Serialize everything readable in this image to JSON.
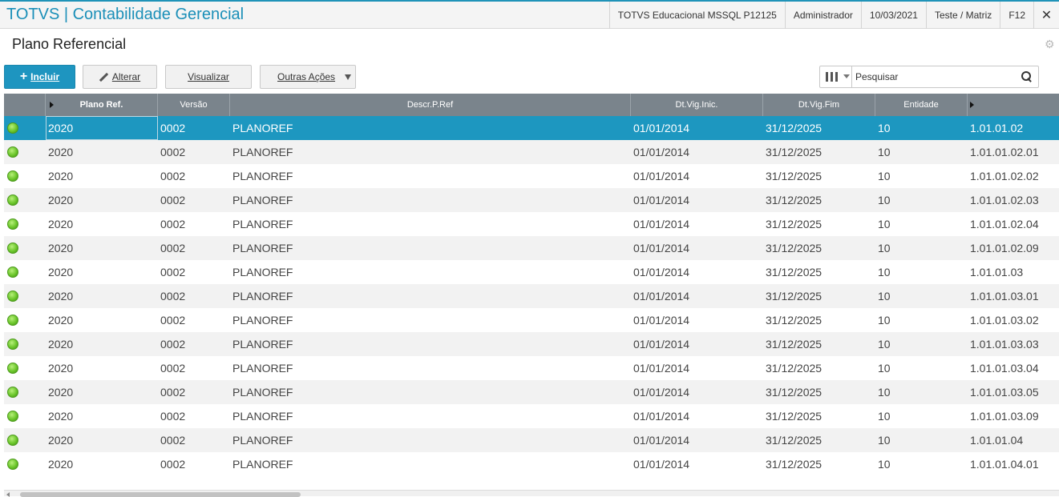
{
  "header": {
    "app_title": "TOTVS | Contabilidade Gerencial",
    "environment": "TOTVS Educacional MSSQL P12125",
    "user": "Administrador",
    "date": "10/03/2021",
    "branch": "Teste / Matriz",
    "help_key": "F12",
    "close_glyph": "✕"
  },
  "page": {
    "title": "Plano Referencial",
    "settings_icon": "gear-icon"
  },
  "toolbar": {
    "incluir_label": "Incluir",
    "alterar_label": "Alterar",
    "visualizar_label": "Visualizar",
    "outras_label": "Outras Ações"
  },
  "search": {
    "placeholder": "Pesquisar",
    "value": ""
  },
  "grid": {
    "columns": [
      "Plano Ref.",
      "Versão",
      "Descr.P.Ref",
      "Dt.Vig.Inic.",
      "Dt.Vig.Fim",
      "Entidade"
    ],
    "selected_row": 0,
    "rows": [
      {
        "plano": "2020",
        "versao": "0002",
        "descr": "PLANOREF",
        "inic": "01/01/2014",
        "fim": "31/12/2025",
        "entidade": "10",
        "conta": "1.01.01.02"
      },
      {
        "plano": "2020",
        "versao": "0002",
        "descr": "PLANOREF",
        "inic": "01/01/2014",
        "fim": "31/12/2025",
        "entidade": "10",
        "conta": "1.01.01.02.01"
      },
      {
        "plano": "2020",
        "versao": "0002",
        "descr": "PLANOREF",
        "inic": "01/01/2014",
        "fim": "31/12/2025",
        "entidade": "10",
        "conta": "1.01.01.02.02"
      },
      {
        "plano": "2020",
        "versao": "0002",
        "descr": "PLANOREF",
        "inic": "01/01/2014",
        "fim": "31/12/2025",
        "entidade": "10",
        "conta": "1.01.01.02.03"
      },
      {
        "plano": "2020",
        "versao": "0002",
        "descr": "PLANOREF",
        "inic": "01/01/2014",
        "fim": "31/12/2025",
        "entidade": "10",
        "conta": "1.01.01.02.04"
      },
      {
        "plano": "2020",
        "versao": "0002",
        "descr": "PLANOREF",
        "inic": "01/01/2014",
        "fim": "31/12/2025",
        "entidade": "10",
        "conta": "1.01.01.02.09"
      },
      {
        "plano": "2020",
        "versao": "0002",
        "descr": "PLANOREF",
        "inic": "01/01/2014",
        "fim": "31/12/2025",
        "entidade": "10",
        "conta": "1.01.01.03"
      },
      {
        "plano": "2020",
        "versao": "0002",
        "descr": "PLANOREF",
        "inic": "01/01/2014",
        "fim": "31/12/2025",
        "entidade": "10",
        "conta": "1.01.01.03.01"
      },
      {
        "plano": "2020",
        "versao": "0002",
        "descr": "PLANOREF",
        "inic": "01/01/2014",
        "fim": "31/12/2025",
        "entidade": "10",
        "conta": "1.01.01.03.02"
      },
      {
        "plano": "2020",
        "versao": "0002",
        "descr": "PLANOREF",
        "inic": "01/01/2014",
        "fim": "31/12/2025",
        "entidade": "10",
        "conta": "1.01.01.03.03"
      },
      {
        "plano": "2020",
        "versao": "0002",
        "descr": "PLANOREF",
        "inic": "01/01/2014",
        "fim": "31/12/2025",
        "entidade": "10",
        "conta": "1.01.01.03.04"
      },
      {
        "plano": "2020",
        "versao": "0002",
        "descr": "PLANOREF",
        "inic": "01/01/2014",
        "fim": "31/12/2025",
        "entidade": "10",
        "conta": "1.01.01.03.05"
      },
      {
        "plano": "2020",
        "versao": "0002",
        "descr": "PLANOREF",
        "inic": "01/01/2014",
        "fim": "31/12/2025",
        "entidade": "10",
        "conta": "1.01.01.03.09"
      },
      {
        "plano": "2020",
        "versao": "0002",
        "descr": "PLANOREF",
        "inic": "01/01/2014",
        "fim": "31/12/2025",
        "entidade": "10",
        "conta": "1.01.01.04"
      },
      {
        "plano": "2020",
        "versao": "0002",
        "descr": "PLANOREF",
        "inic": "01/01/2014",
        "fim": "31/12/2025",
        "entidade": "10",
        "conta": "1.01.01.04.01"
      }
    ]
  }
}
